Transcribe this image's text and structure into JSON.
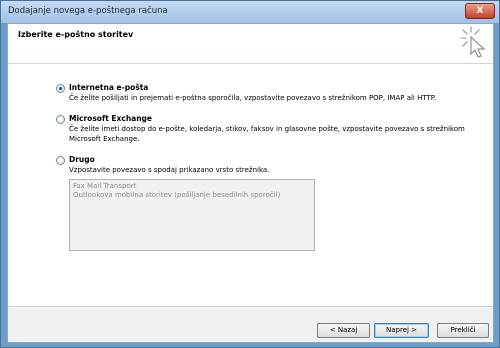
{
  "window": {
    "title": "Dodajanje novega e-poštnega računa",
    "close_label": "X"
  },
  "header": {
    "title": "Izberite e-poštno storitev",
    "icon": "sparkle-cursor-icon"
  },
  "options": [
    {
      "label": "Internetna e-pošta",
      "checked": true,
      "description": "Če želite pošiljati in prejemati e-poštna sporočila, vzpostavite povezavo s strežnikom POP, IMAP ali HTTP."
    },
    {
      "label": "Microsoft Exchange",
      "checked": false,
      "description": "Če želite imeti dostop do e-pošte, koledarja, stikov, faksov in glasovne pošte, vzpostavite povezavo s strežnikom Microsoft Exchange."
    },
    {
      "label": "Drugo",
      "checked": false,
      "description": "Vzpostavite povezavo s spodaj prikazano vrsto strežnika."
    }
  ],
  "server_types": [
    "Fax Mail Transport",
    "Outlookova mobilna storitev (pošiljanje besedilnih sporočil)"
  ],
  "buttons": {
    "back": "< Nazaj",
    "next": "Naprej >",
    "cancel": "Prekliči"
  }
}
